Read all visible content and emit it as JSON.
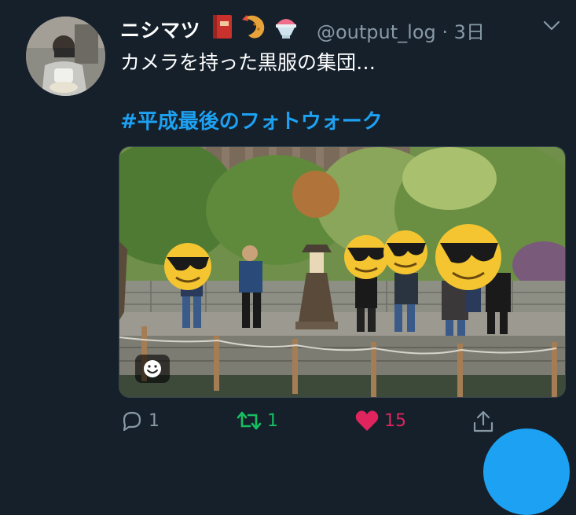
{
  "user": {
    "display_name": "ニシマツ",
    "name_emojis": [
      "book-emoji",
      "fried-shrimp-emoji",
      "shaved-ice-emoji"
    ],
    "handle": "@output_log",
    "separator": "·",
    "time": "3日"
  },
  "tweet": {
    "text": "カメラを持った黒服の集団…",
    "hashtag": "#平成最後のフォトウォーク"
  },
  "actions": {
    "reply_count": "1",
    "retweet_count": "1",
    "like_count": "15"
  },
  "colors": {
    "background": "#15202b",
    "secondary_text": "#8899a6",
    "link": "#1da1f2",
    "retweet": "#17bf63",
    "like": "#e0245e"
  }
}
